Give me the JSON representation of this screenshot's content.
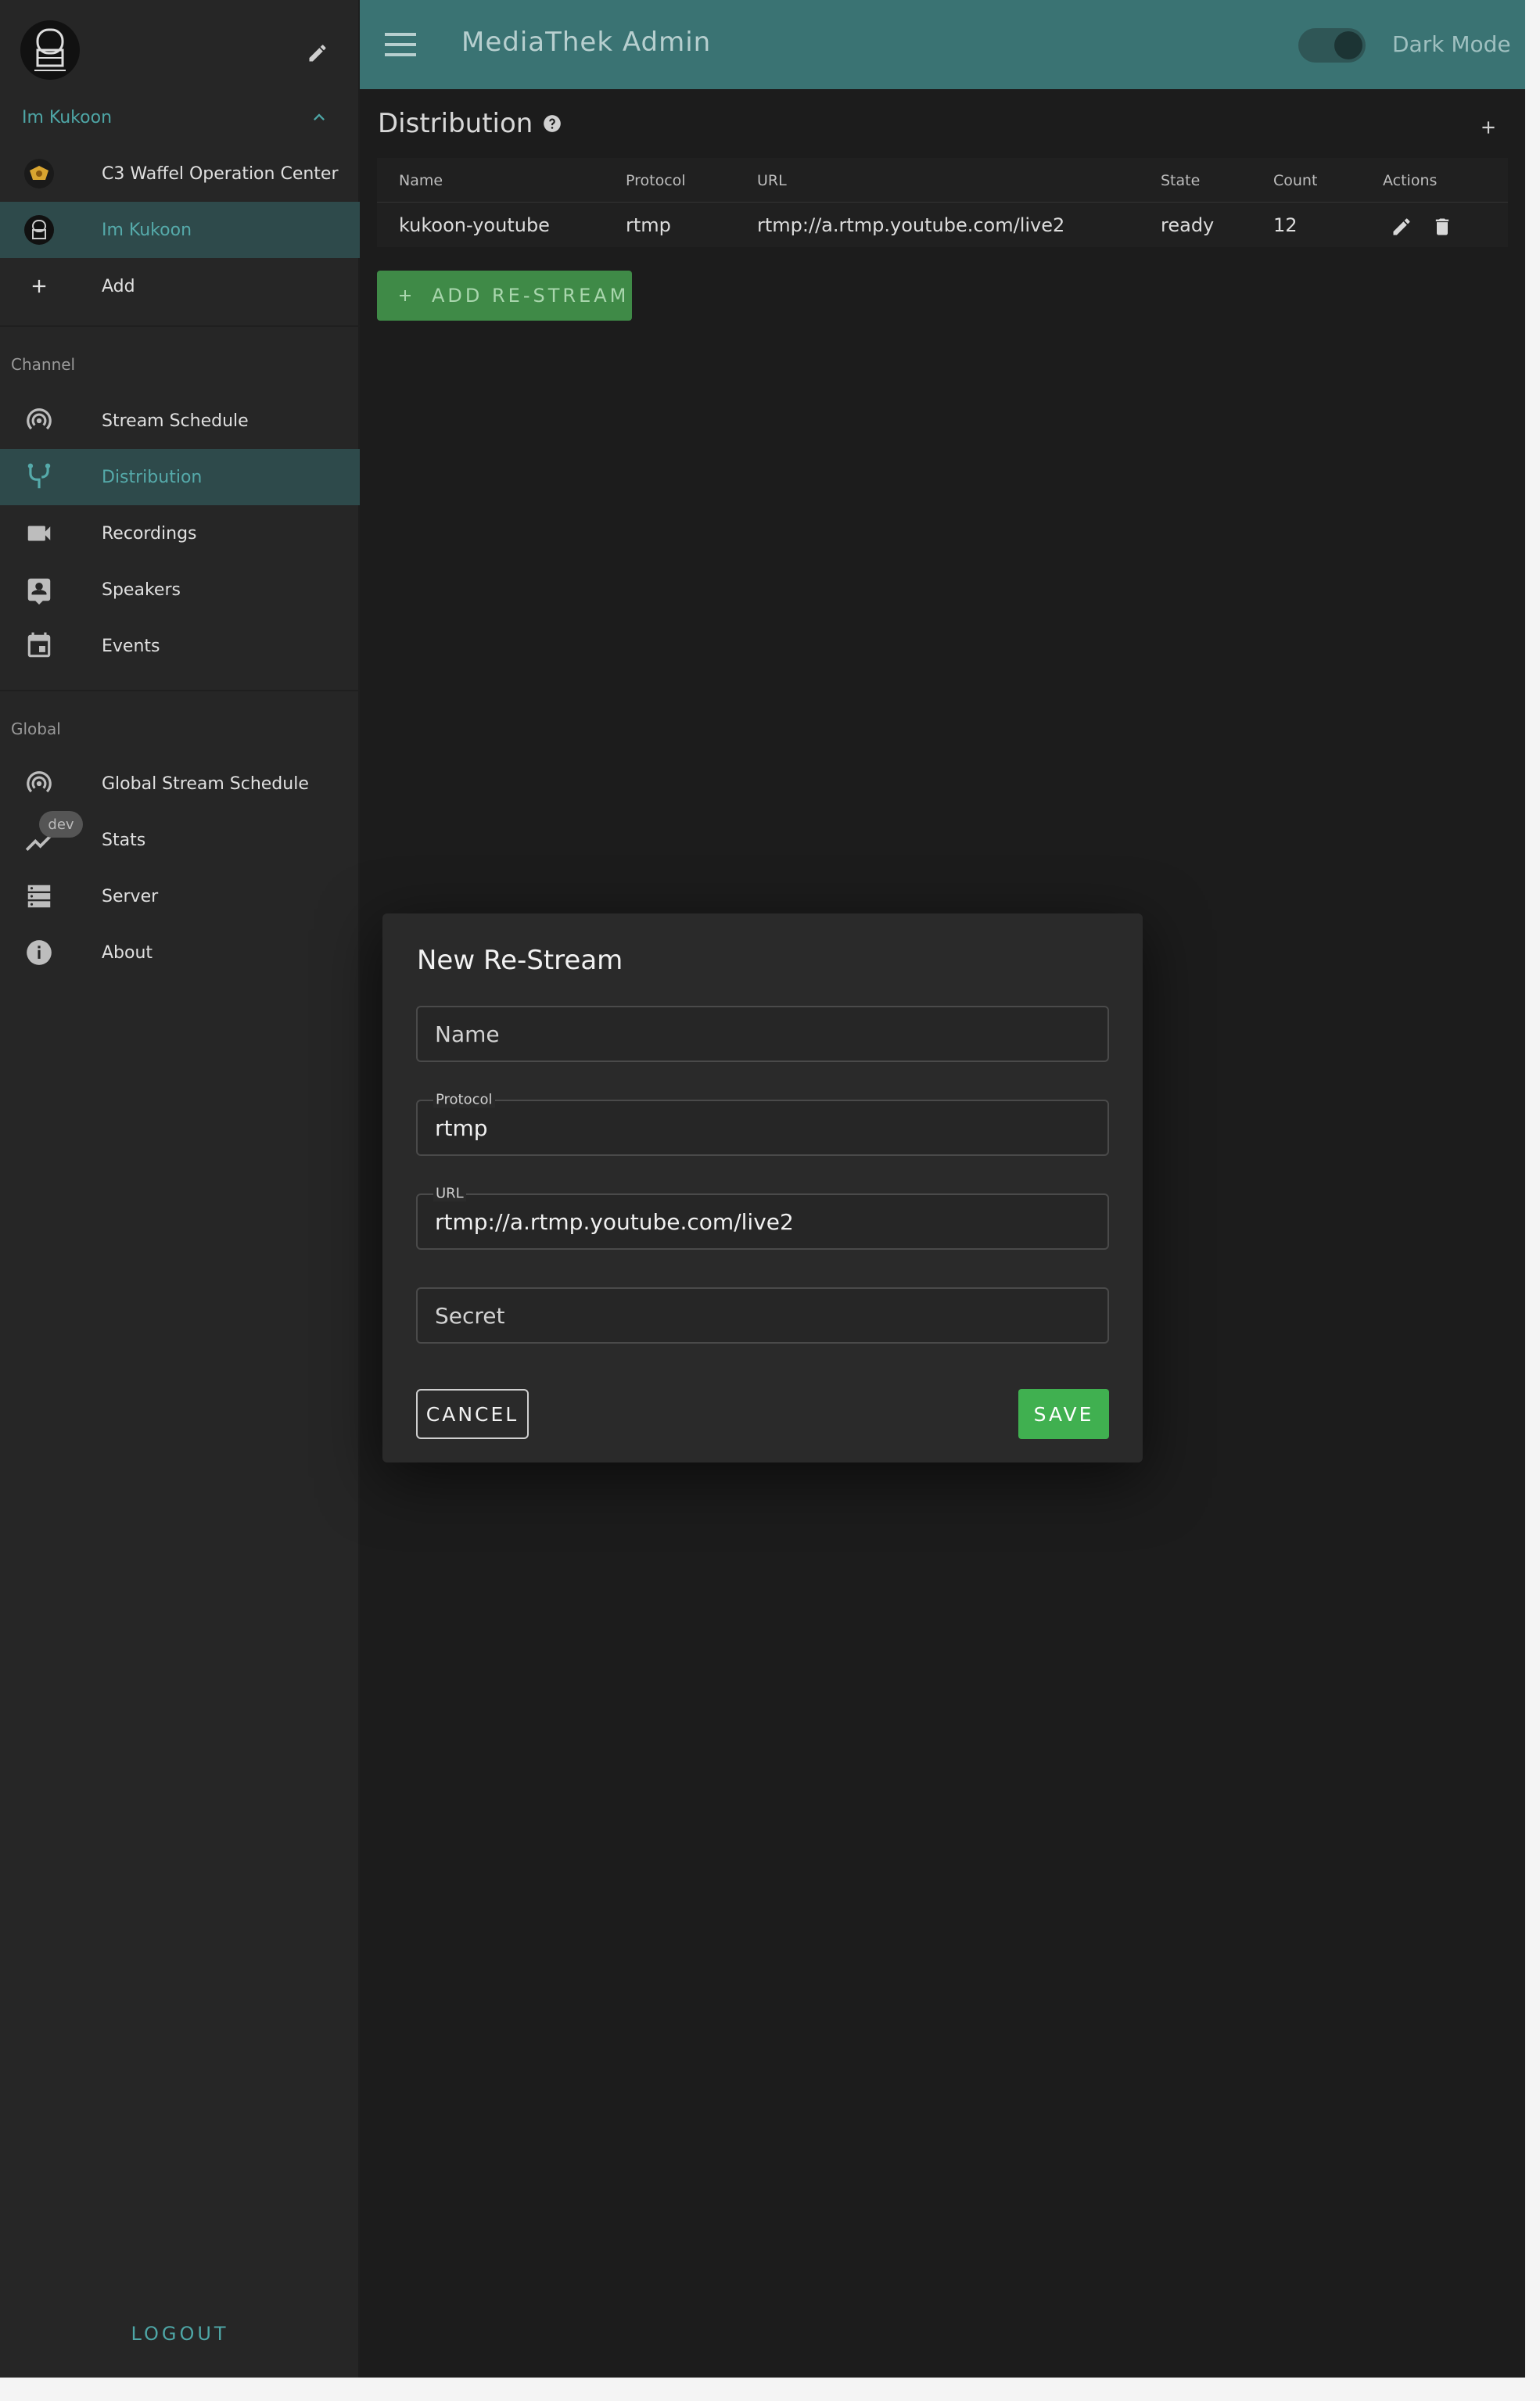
{
  "topbar": {
    "title": "MediaThek Admin",
    "dark_mode_label": "Dark Mode"
  },
  "account": {
    "current": "Im Kukoon"
  },
  "sidebar": {
    "accounts": [
      {
        "label": "C3 Waffel Operation Center"
      },
      {
        "label": "Im Kukoon"
      },
      {
        "label": "Add"
      }
    ],
    "channel_section": "Channel",
    "channel_items": [
      {
        "label": "Stream Schedule"
      },
      {
        "label": "Distribution"
      },
      {
        "label": "Recordings"
      },
      {
        "label": "Speakers"
      },
      {
        "label": "Events"
      }
    ],
    "global_section": "Global",
    "global_items": [
      {
        "label": "Global Stream Schedule"
      },
      {
        "label": "Stats"
      },
      {
        "label": "Server"
      },
      {
        "label": "About"
      }
    ],
    "dev_badge": "dev",
    "logout": "LOGOUT"
  },
  "page": {
    "title": "Distribution"
  },
  "table": {
    "headers": [
      "Name",
      "Protocol",
      "URL",
      "State",
      "Count",
      "Actions"
    ],
    "rows": [
      [
        "kukoon-youtube",
        "rtmp",
        "rtmp://a.rtmp.youtube.com/live2",
        "ready",
        "12"
      ]
    ]
  },
  "add_button": "ADD RE-STREAM",
  "dialog": {
    "title": "New Re-Stream",
    "name_placeholder": "Name",
    "protocol_label": "Protocol",
    "protocol_value": "rtmp",
    "url_label": "URL",
    "url_value": "rtmp://a.rtmp.youtube.com/live2",
    "secret_placeholder": "Secret",
    "cancel": "CANCEL",
    "save": "SAVE"
  },
  "colors": {
    "accent": "#3a7373",
    "active_bg": "#2e4a4b",
    "save_green": "#40b050",
    "add_green": "#3f8a47"
  }
}
